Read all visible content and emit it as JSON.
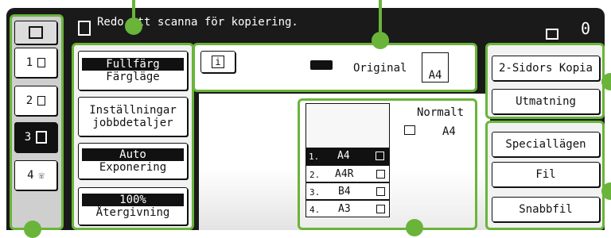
{
  "status_bar": {
    "message": "Redo att scanna för kopiering.",
    "copy_count": "0"
  },
  "left_tabs": [
    {
      "label": "1",
      "icon": "copy-icon"
    },
    {
      "label": "2",
      "icon": "document-icon"
    },
    {
      "label": "3",
      "icon": "multi-document-icon",
      "selected": true
    },
    {
      "label": "4",
      "icon": "fax-icon"
    }
  ],
  "settings": {
    "color_mode": {
      "value": "Fullfärg",
      "label": "Färgläge"
    },
    "job_details": {
      "line1": "Inställningar",
      "line2": "jobbdetaljer"
    },
    "exposure": {
      "value": "Auto",
      "label": "Exponering"
    },
    "ratio": {
      "value": "100%",
      "label": "Återgivning"
    }
  },
  "original": {
    "label": "Original",
    "size": "A4"
  },
  "output": {
    "mode": "Normalt",
    "size": "A4"
  },
  "trays": [
    {
      "num": "1.",
      "size": "A4",
      "selected": true
    },
    {
      "num": "2.",
      "size": "A4R"
    },
    {
      "num": "3.",
      "size": "B4"
    },
    {
      "num": "4.",
      "size": "A3"
    }
  ],
  "right_buttons": {
    "two_sided": "2-Sidors Kopia",
    "output": "Utmatning",
    "special": "Speciallägen",
    "file": "Fil",
    "quick_file": "Snabbfil"
  },
  "colors": {
    "accent": "#6ab43a",
    "panel": "#1a1a1a"
  }
}
